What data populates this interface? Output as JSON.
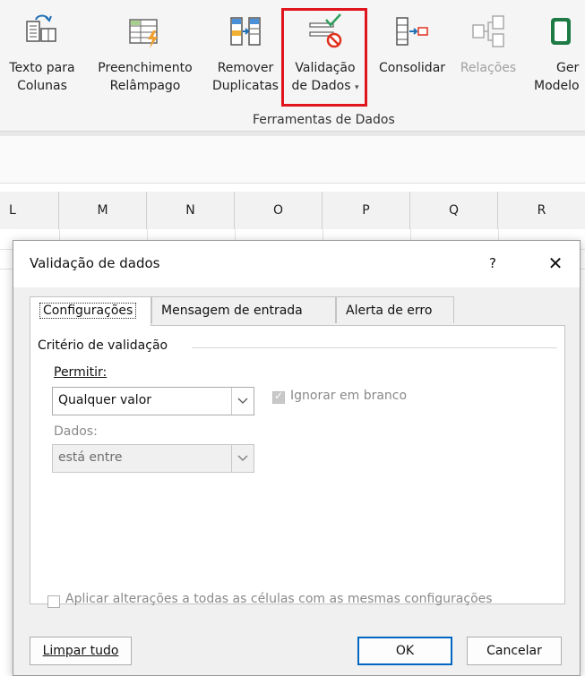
{
  "ribbon": {
    "buttons": [
      {
        "line1": "Texto para",
        "line2": "Colunas",
        "icon": "text-to-columns-icon"
      },
      {
        "line1": "Preenchimento",
        "line2": "Relâmpago",
        "icon": "flash-fill-icon"
      },
      {
        "line1": "Remover",
        "line2": "Duplicatas",
        "icon": "remove-duplicates-icon"
      },
      {
        "line1": "Validação",
        "line2": "de Dados",
        "icon": "data-validation-icon"
      },
      {
        "line1": "Consolidar",
        "line2": "",
        "icon": "consolidate-icon"
      },
      {
        "line1": "Relações",
        "line2": "",
        "icon": "relationships-icon"
      },
      {
        "line1": "Ger",
        "line2": "Modelo",
        "icon": "data-model-icon"
      }
    ],
    "group_label": "Ferramentas de Dados",
    "highlight_color": "#e0141c"
  },
  "columns": [
    "L",
    "M",
    "N",
    "O",
    "P",
    "Q",
    "R"
  ],
  "dialog": {
    "title": "Validação de dados",
    "help": "?",
    "close": "✕",
    "tabs": [
      "Configurações",
      "Mensagem de entrada",
      "Alerta de erro"
    ],
    "section": "Critério de validação",
    "permitir_label": "Permitir:",
    "permitir_value": "Qualquer valor",
    "ignore_blank": "Ignorar em branco",
    "dados_label": "Dados:",
    "dados_value": "está entre",
    "apply_all": "Aplicar alterações a todas as células com as mesmas configurações",
    "clear_button": "Limpar tudo",
    "ok_button": "OK",
    "cancel_button": "Cancelar",
    "accent": "#0067c0"
  }
}
